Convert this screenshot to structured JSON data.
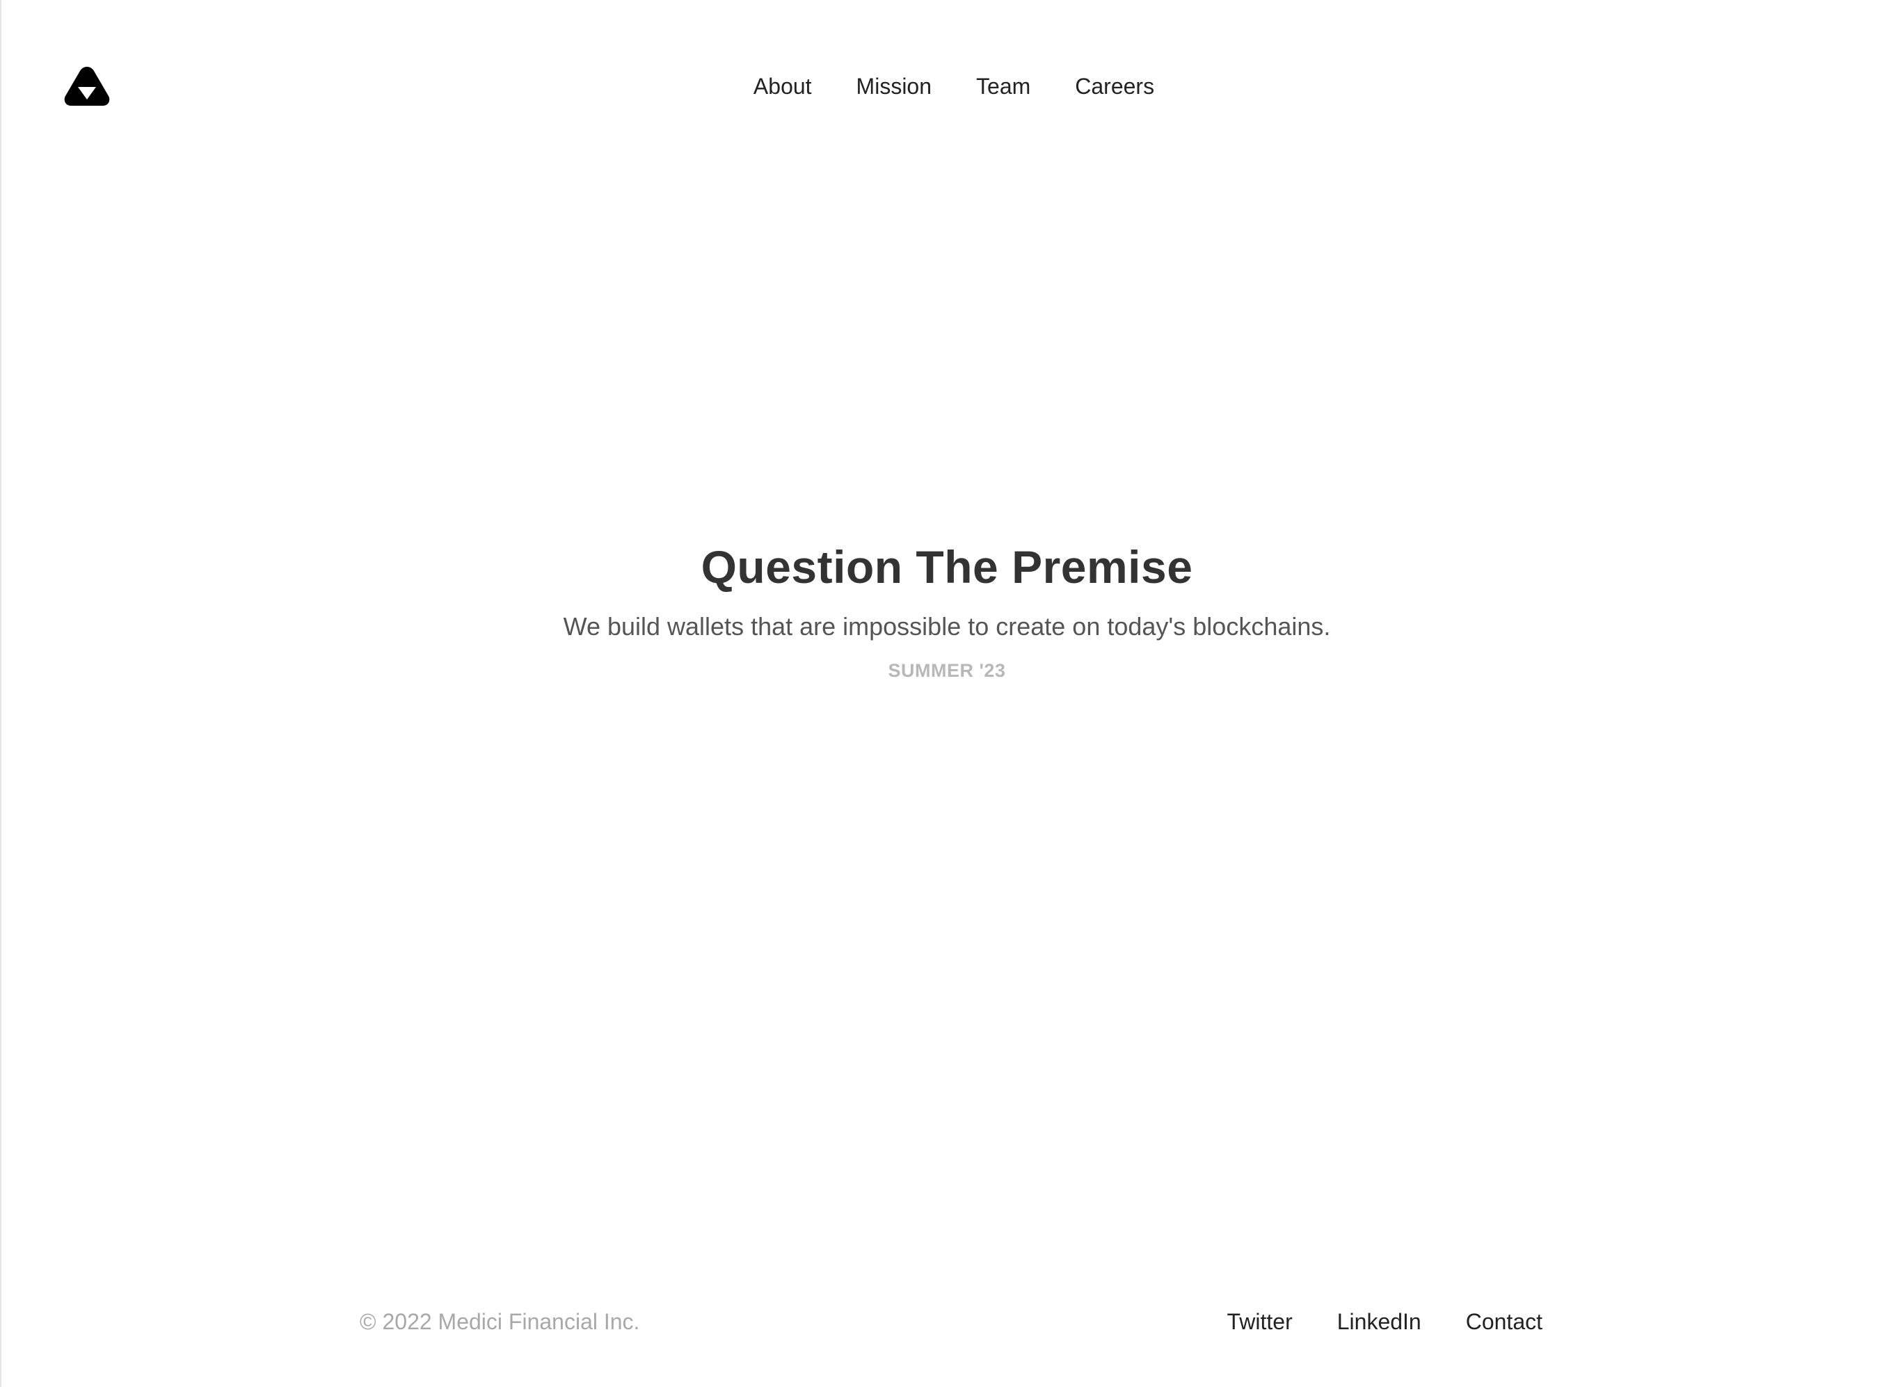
{
  "header": {
    "logo_icon": "triangle-logo-icon",
    "nav": [
      {
        "label": "About"
      },
      {
        "label": "Mission"
      },
      {
        "label": "Team"
      },
      {
        "label": "Careers"
      }
    ]
  },
  "hero": {
    "title": "Question The Premise",
    "subtitle": "We build wallets that are impossible to create on today's blockchains.",
    "tag": "SUMMER '23"
  },
  "footer": {
    "copyright": "© 2022 Medici Financial Inc.",
    "links": [
      {
        "label": "Twitter"
      },
      {
        "label": "LinkedIn"
      },
      {
        "label": "Contact"
      }
    ]
  },
  "colors": {
    "background": "#ffffff",
    "text_primary": "#222222",
    "title": "#333333",
    "subtitle": "#555555",
    "muted": "#b8b8b8"
  }
}
